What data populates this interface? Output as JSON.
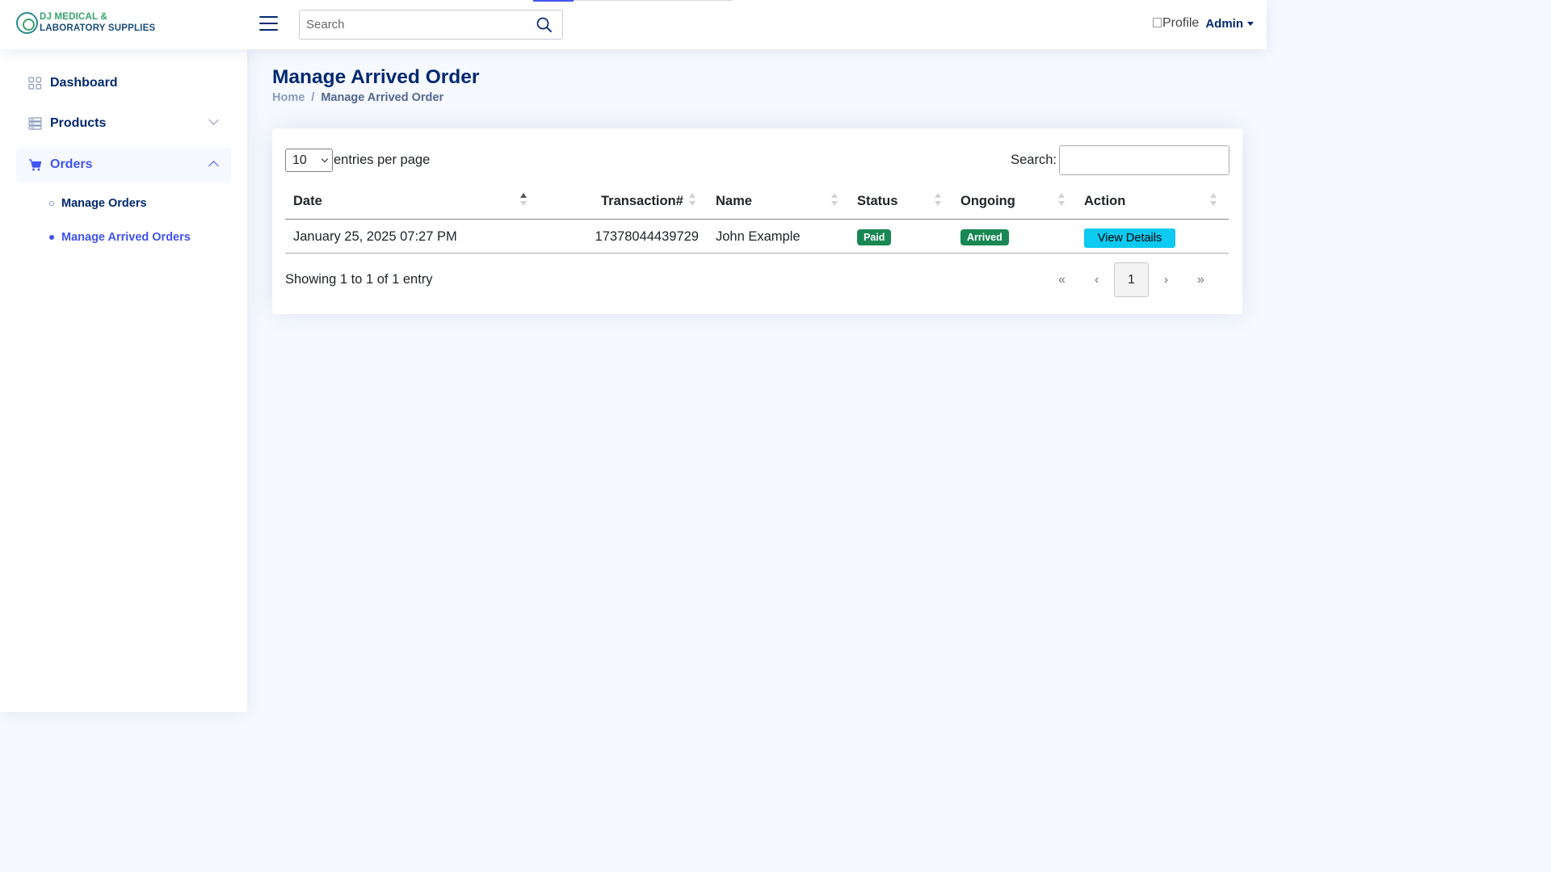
{
  "brand": {
    "line1": "DJ MEDICAL &",
    "line2": "LABORATORY SUPPLIES"
  },
  "header": {
    "search_placeholder": "Search",
    "profile_img_alt": "Profile",
    "user_name": "Admin"
  },
  "sidebar": {
    "items": [
      {
        "label": "Dashboard"
      },
      {
        "label": "Products"
      },
      {
        "label": "Orders"
      }
    ],
    "sub_items": [
      {
        "label": "Manage Orders"
      },
      {
        "label": "Manage Arrived Orders"
      }
    ]
  },
  "page": {
    "title": "Manage Arrived Order",
    "breadcrumb": {
      "home": "Home",
      "separator": "/",
      "current": "Manage Arrived Order"
    }
  },
  "table": {
    "per_page_value": "10",
    "per_page_label": "entries per page",
    "search_label": "Search:",
    "columns": [
      "Date",
      "Transaction#",
      "Name",
      "Status",
      "Ongoing",
      "Action"
    ],
    "rows": [
      {
        "date": "January 25, 2025 07:27 PM",
        "transaction": "17378044439729",
        "name": "John Example",
        "status": "Paid",
        "ongoing": "Arrived",
        "action": "View Details"
      }
    ],
    "info": "Showing 1 to 1 of 1 entry",
    "pagination": {
      "first": "«",
      "prev": "‹",
      "current": "1",
      "next": "›",
      "last": "»"
    }
  },
  "colors": {
    "primary": "#012970",
    "accent": "#4154f1",
    "success": "#198754",
    "info": "#0dcaf0"
  }
}
